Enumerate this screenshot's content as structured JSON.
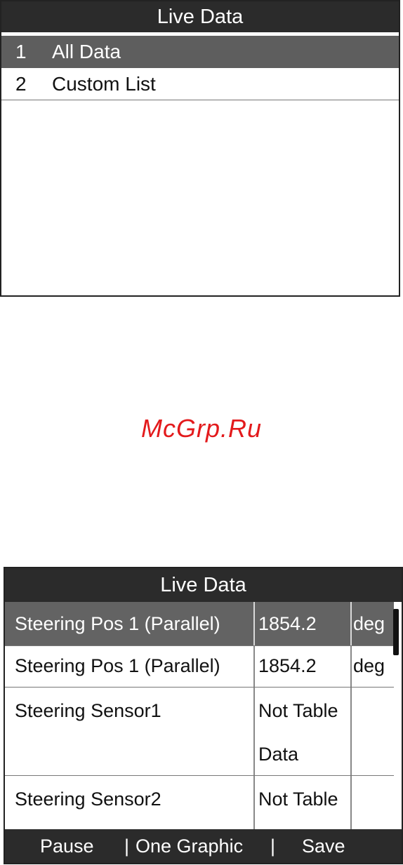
{
  "screen1": {
    "title": "Live Data",
    "items": [
      {
        "num": "1",
        "label": "All Data",
        "selected": true
      },
      {
        "num": "2",
        "label": "Custom List",
        "selected": false
      }
    ]
  },
  "watermark": "McGrp.Ru",
  "screen2": {
    "title": "Live Data",
    "rows": [
      {
        "name": "Steering Pos 1 (Parallel)",
        "value": "1854.2",
        "unit": "deg",
        "selected": true
      },
      {
        "name": "Steering Pos 1 (Parallel)",
        "value": "1854.2",
        "unit": "deg",
        "selected": false
      },
      {
        "name": "Steering Sensor1",
        "value_line1": "Not Table",
        "value_line2": "Data",
        "unit": ""
      },
      {
        "name": "Steering Sensor2",
        "value_line1": "Not Table",
        "unit": ""
      }
    ],
    "buttons": {
      "pause": "Pause",
      "separator": "|",
      "one_graphic": "One Graphic",
      "save": "Save"
    }
  },
  "colors": {
    "titlebar": "#2b2b2b",
    "selected_row": "#5e5e5e",
    "watermark": "#e31a1c"
  }
}
